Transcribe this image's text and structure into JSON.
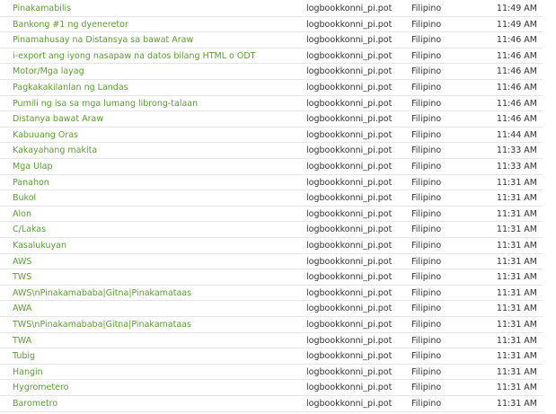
{
  "colors": {
    "link": "#5a9e2f",
    "text": "#333333",
    "divider": "#e6e6e6"
  },
  "rows": [
    {
      "string": "Pinakamabilis",
      "file": "logbookkonni_pi.pot",
      "language": "Filipino",
      "time": "11:49 AM"
    },
    {
      "string": "Bankong #1 ng dyeneretor",
      "file": "logbookkonni_pi.pot",
      "language": "Filipino",
      "time": "11:49 AM"
    },
    {
      "string": "Pinamahusay na Distansya sa bawat Araw",
      "file": "logbookkonni_pi.pot",
      "language": "Filipino",
      "time": "11:46 AM"
    },
    {
      "string": "i-export ang iyong nasapaw na datos bilang HTML o ODT",
      "file": "logbookkonni_pi.pot",
      "language": "Filipino",
      "time": "11:46 AM"
    },
    {
      "string": "Motor/Mga layag",
      "file": "logbookkonni_pi.pot",
      "language": "Filipino",
      "time": "11:46 AM"
    },
    {
      "string": "Pagkakakilanlan ng Landas",
      "file": "logbookkonni_pi.pot",
      "language": "Filipino",
      "time": "11:46 AM"
    },
    {
      "string": "Pumili ng isa sa mga lumang librong-talaan",
      "file": "logbookkonni_pi.pot",
      "language": "Filipino",
      "time": "11:46 AM"
    },
    {
      "string": "Distanya bawat Araw",
      "file": "logbookkonni_pi.pot",
      "language": "Filipino",
      "time": "11:46 AM"
    },
    {
      "string": "Kabuuang Oras",
      "file": "logbookkonni_pi.pot",
      "language": "Filipino",
      "time": "11:44 AM"
    },
    {
      "string": "Kakayahang makita",
      "file": "logbookkonni_pi.pot",
      "language": "Filipino",
      "time": "11:33 AM"
    },
    {
      "string": "Mga Ulap",
      "file": "logbookkonni_pi.pot",
      "language": "Filipino",
      "time": "11:33 AM"
    },
    {
      "string": "Panahon",
      "file": "logbookkonni_pi.pot",
      "language": "Filipino",
      "time": "11:31 AM"
    },
    {
      "string": "Bukol",
      "file": "logbookkonni_pi.pot",
      "language": "Filipino",
      "time": "11:31 AM"
    },
    {
      "string": "Alon",
      "file": "logbookkonni_pi.pot",
      "language": "Filipino",
      "time": "11:31 AM"
    },
    {
      "string": "C/Lakas",
      "file": "logbookkonni_pi.pot",
      "language": "Filipino",
      "time": "11:31 AM"
    },
    {
      "string": "Kasalukuyan",
      "file": "logbookkonni_pi.pot",
      "language": "Filipino",
      "time": "11:31 AM"
    },
    {
      "string": "AWS",
      "file": "logbookkonni_pi.pot",
      "language": "Filipino",
      "time": "11:31 AM"
    },
    {
      "string": "TWS",
      "file": "logbookkonni_pi.pot",
      "language": "Filipino",
      "time": "11:31 AM"
    },
    {
      "string": "AWS\\nPinakamababa|Gitna|Pinakamataas",
      "file": "logbookkonni_pi.pot",
      "language": "Filipino",
      "time": "11:31 AM"
    },
    {
      "string": "AWA",
      "file": "logbookkonni_pi.pot",
      "language": "Filipino",
      "time": "11:31 AM"
    },
    {
      "string": "TWS\\nPinakamababa|Gitna|Pinakamataas",
      "file": "logbookkonni_pi.pot",
      "language": "Filipino",
      "time": "11:31 AM"
    },
    {
      "string": "TWA",
      "file": "logbookkonni_pi.pot",
      "language": "Filipino",
      "time": "11:31 AM"
    },
    {
      "string": "Tubig",
      "file": "logbookkonni_pi.pot",
      "language": "Filipino",
      "time": "11:31 AM"
    },
    {
      "string": "Hangin",
      "file": "logbookkonni_pi.pot",
      "language": "Filipino",
      "time": "11:31 AM"
    },
    {
      "string": "Hygrometero",
      "file": "logbookkonni_pi.pot",
      "language": "Filipino",
      "time": "11:31 AM"
    },
    {
      "string": "Barometro",
      "file": "logbookkonni_pi.pot",
      "language": "Filipino",
      "time": "11:31 AM"
    }
  ]
}
